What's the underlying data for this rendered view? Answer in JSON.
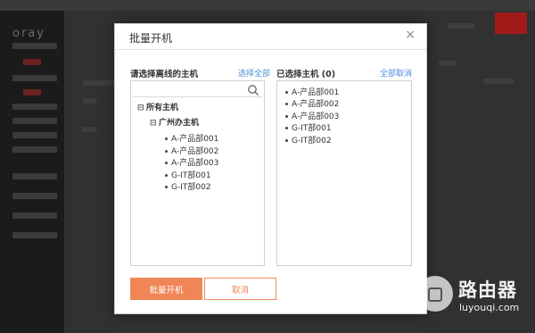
{
  "background": {
    "logo": "oray"
  },
  "modal": {
    "title": "批量开机",
    "close_icon": "×"
  },
  "left_column": {
    "label": "请选择离线的主机",
    "select_all": "选择全部",
    "search_placeholder": "",
    "tree": {
      "root": {
        "toggle": "⊟",
        "label": "所有主机"
      },
      "group": {
        "toggle": "⊟",
        "label": "广州办主机"
      },
      "hosts": [
        "A-产品部001",
        "A-产品部002",
        "A-产品部003",
        "G-IT部001",
        "G-IT部002"
      ]
    }
  },
  "right_column": {
    "label": "已选择主机 (0)",
    "deselect_all": "全部取消",
    "hosts": [
      "A-产品部001",
      "A-产品部002",
      "A-产品部003",
      "G-IT部001",
      "G-IT部002"
    ]
  },
  "buttons": {
    "confirm": "批量开机",
    "cancel": "取消"
  },
  "watermark": {
    "text": "路由器",
    "url": "luyouqi.com"
  },
  "colors": {
    "accent": "#f08658",
    "link": "#4a90d9"
  }
}
